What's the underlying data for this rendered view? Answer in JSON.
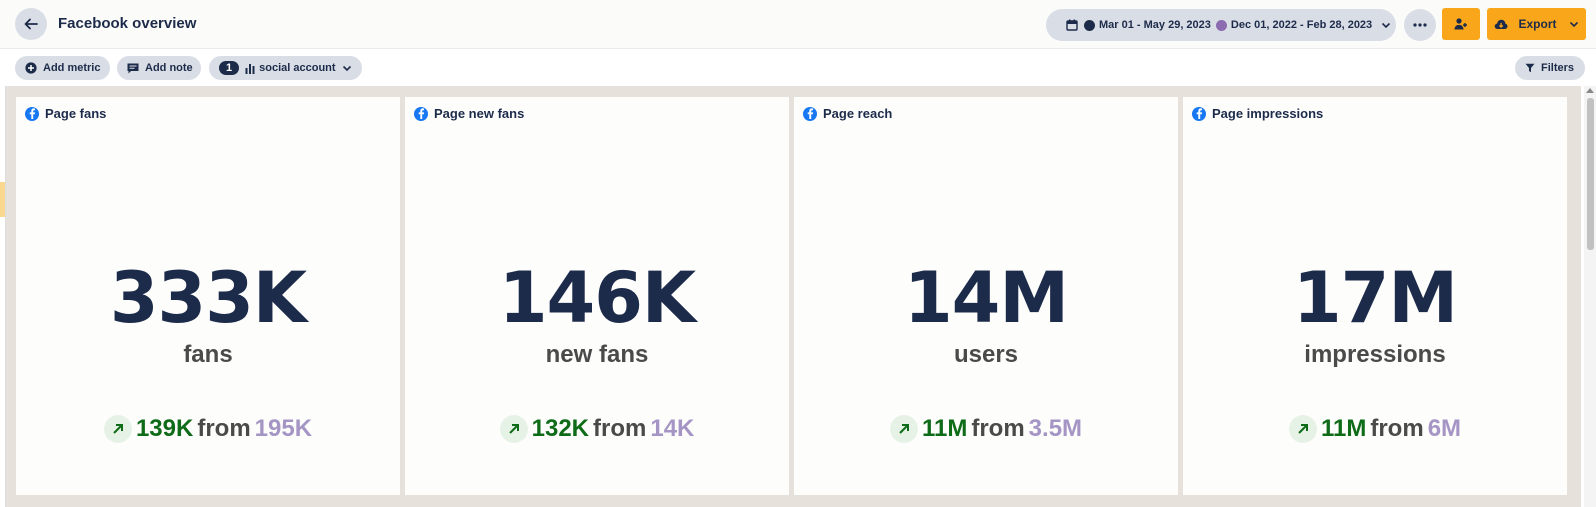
{
  "header": {
    "title": "Facebook overview",
    "date_range_current": "Mar 01 - May 29, 2023",
    "date_range_previous": "Dec 01, 2022 - Feb 28, 2023",
    "current_color": "#1d2b4a",
    "previous_color": "#8c6bb1",
    "export_label": "Export"
  },
  "toolbar": {
    "add_metric_label": "Add metric",
    "add_note_label": "Add note",
    "account_count": "1",
    "account_label": "social account",
    "filters_label": "Filters"
  },
  "cards": [
    {
      "title": "Page fans",
      "value": "333K",
      "unit": "fans",
      "current": "139K",
      "from": "from",
      "previous": "195K"
    },
    {
      "title": "Page new fans",
      "value": "146K",
      "unit": "new fans",
      "current": "132K",
      "from": "from",
      "previous": "14K"
    },
    {
      "title": "Page reach",
      "value": "14M",
      "unit": "users",
      "current": "11M",
      "from": "from",
      "previous": "3.5M"
    },
    {
      "title": "Page impressions",
      "value": "17M",
      "unit": "impressions",
      "current": "11M",
      "from": "from",
      "previous": "6M"
    }
  ],
  "colors": {
    "accent": "#f9a61b",
    "primary_text": "#1d2b4a",
    "trend_up": "#0e6b18",
    "previous_value": "#a595c5",
    "facebook_blue": "#1877f2"
  }
}
